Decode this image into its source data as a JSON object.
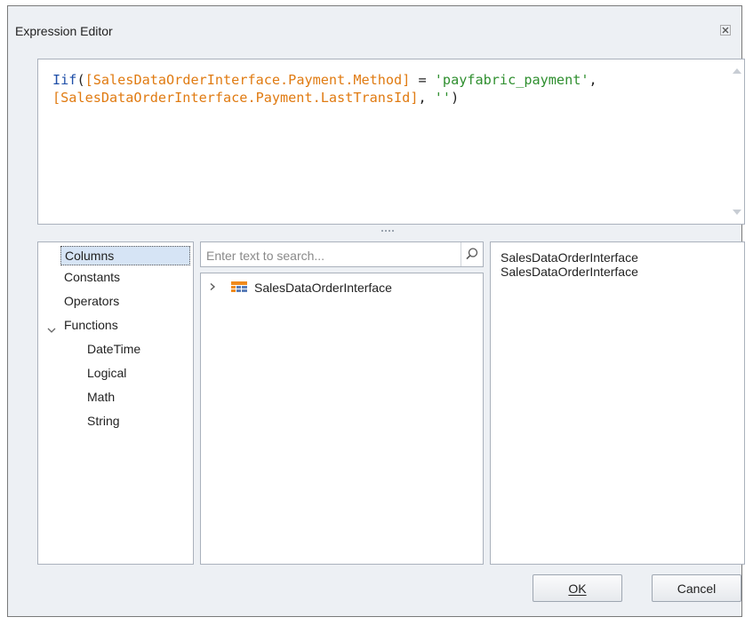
{
  "window": {
    "title": "Expression Editor",
    "close_glyph": "✕"
  },
  "expression": {
    "line1": {
      "func": "Iif",
      "open": "(",
      "field1": "[SalesDataOrderInterface.Payment.Method]",
      "op": " = ",
      "str": "'payfabric_payment'",
      "comma": ","
    },
    "line2": {
      "field2": "[SalesDataOrderInterface.Payment.LastTransId]",
      "comma": ", ",
      "empty_str": "''",
      "close": ")"
    }
  },
  "categories": {
    "columns": "Columns",
    "constants": "Constants",
    "operators": "Operators",
    "functions": "Functions",
    "functions_expanded_icon": "chevron-down-icon",
    "function_types": {
      "datetime": "DateTime",
      "logical": "Logical",
      "math": "Math",
      "string": "String"
    }
  },
  "search": {
    "placeholder": "Enter text to search...",
    "value": "",
    "icon": "search-icon"
  },
  "tree": {
    "node": {
      "expander": "›",
      "icon": "table-icon",
      "label": "SalesDataOrderInterface"
    }
  },
  "description": {
    "line1": "SalesDataOrderInterface",
    "line2": "SalesDataOrderInterface"
  },
  "buttons": {
    "ok": "OK",
    "cancel": "Cancel"
  },
  "colors": {
    "keyword": "#1f4fa8",
    "field": "#e07b12",
    "string": "#2f8f2f",
    "selection": "#d6e4f5",
    "table_icon_orange": "#f08a1c",
    "table_icon_blue": "#5a7db8"
  }
}
